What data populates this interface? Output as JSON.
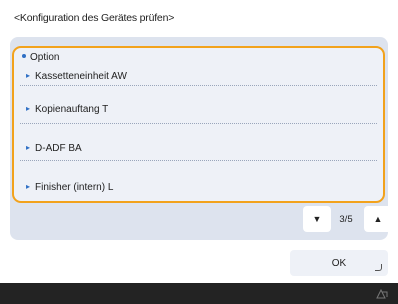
{
  "header": {
    "title": "<Konfiguration des Gerätes prüfen>"
  },
  "list": {
    "group_label": "Option",
    "items": [
      {
        "label": "Kassetteneinheit AW"
      },
      {
        "label": "Kopienauftang T"
      },
      {
        "label": "D-ADF BA"
      },
      {
        "label": "Finisher (intern) L"
      }
    ]
  },
  "pager": {
    "down_icon": "triangle-down",
    "up_icon": "triangle-up",
    "indicator": "3/5"
  },
  "ok_button": {
    "label": "OK"
  },
  "colors": {
    "accent": "#f2a21c",
    "panel": "#dde3ee",
    "bullet": "#2f6fc4",
    "bottom_bar": "#232323"
  }
}
